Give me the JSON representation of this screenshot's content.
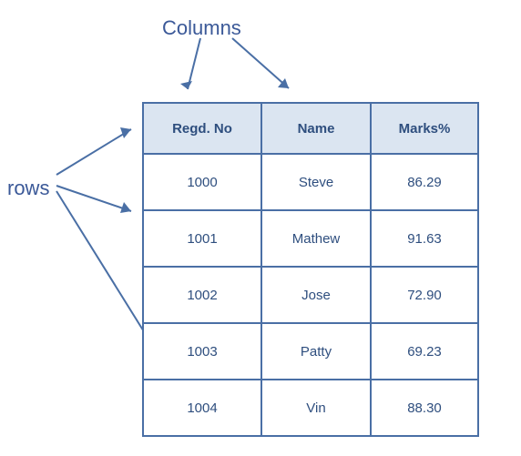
{
  "labels": {
    "columns": "Columns",
    "rows": "rows"
  },
  "table": {
    "headers": {
      "regd": "Regd. No",
      "name": "Name",
      "marks": "Marks%"
    },
    "rows": [
      {
        "regd": "1000",
        "name": "Steve",
        "marks": "86.29"
      },
      {
        "regd": "1001",
        "name": "Mathew",
        "marks": "91.63"
      },
      {
        "regd": "1002",
        "name": "Jose",
        "marks": "72.90"
      },
      {
        "regd": "1003",
        "name": "Patty",
        "marks": "69.23"
      },
      {
        "regd": "1004",
        "name": "Vin",
        "marks": "88.30"
      }
    ]
  }
}
